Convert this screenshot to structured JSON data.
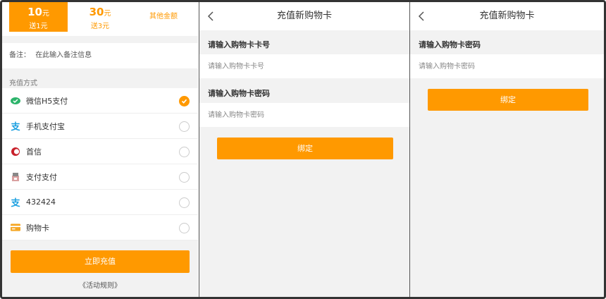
{
  "panel1": {
    "amounts": [
      {
        "value": "10",
        "unit": "元",
        "bonus": "送1元"
      },
      {
        "value": "30",
        "unit": "元",
        "bonus": "送3元"
      }
    ],
    "other_amount": "其他金额",
    "remark_label": "备注：",
    "remark_placeholder": "在此输入备注信息",
    "section_label": "充值方式",
    "payment_methods": [
      {
        "label": "微信H5支付",
        "icon": "wechat-pay-icon",
        "selected": true
      },
      {
        "label": "手机支付宝",
        "icon": "alipay-icon",
        "selected": false
      },
      {
        "label": "首信",
        "icon": "shouxin-icon",
        "selected": false
      },
      {
        "label": "支付支付",
        "icon": "pay-box-icon",
        "selected": false
      },
      {
        "label": "432424",
        "icon": "alipay-icon",
        "selected": false
      },
      {
        "label": "购物卡",
        "icon": "card-icon",
        "selected": false
      }
    ],
    "submit_label": "立即充值",
    "rules_link": "《活动规则》"
  },
  "panel2": {
    "title": "充值新购物卡",
    "card_number_label": "请输入购物卡卡号",
    "card_number_placeholder": "请输入购物卡卡号",
    "password_label": "请输入购物卡密码",
    "password_placeholder": "请输入购物卡密码",
    "bind_label": "绑定"
  },
  "panel3": {
    "title": "充值新购物卡",
    "password_label": "请输入购物卡密码",
    "password_placeholder": "请输入购物卡密码",
    "bind_label": "绑定"
  },
  "colors": {
    "accent": "#ff9900",
    "wechat": "#2db46b",
    "alipay": "#1a9fe0",
    "shouxin": "#c8202b"
  }
}
